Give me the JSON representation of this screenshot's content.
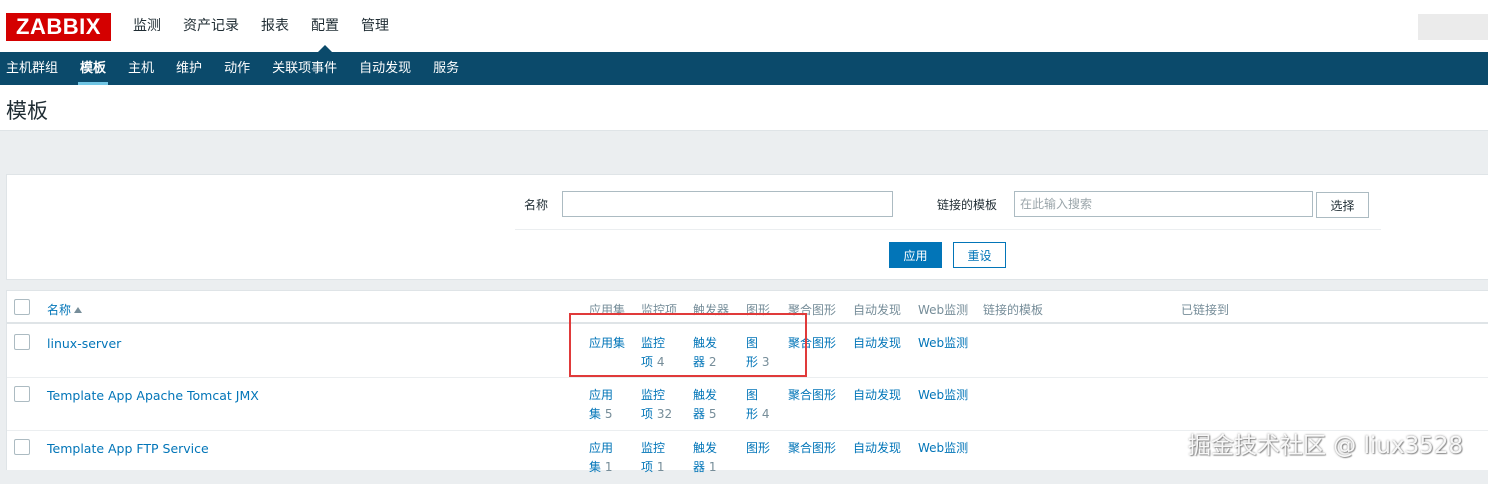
{
  "logo": "ZABBIX",
  "top_menu": [
    {
      "label": "监测",
      "active": false
    },
    {
      "label": "资产记录",
      "active": false
    },
    {
      "label": "报表",
      "active": false
    },
    {
      "label": "配置",
      "active": true
    },
    {
      "label": "管理",
      "active": false
    }
  ],
  "sub_menu": [
    {
      "label": "主机群组",
      "active": false
    },
    {
      "label": "模板",
      "active": true
    },
    {
      "label": "主机",
      "active": false
    },
    {
      "label": "维护",
      "active": false
    },
    {
      "label": "动作",
      "active": false
    },
    {
      "label": "关联项事件",
      "active": false
    },
    {
      "label": "自动发现",
      "active": false
    },
    {
      "label": "服务",
      "active": false
    }
  ],
  "page_title": "模板",
  "filter": {
    "name_label": "名称",
    "name_value": "",
    "linked_label": "链接的模板",
    "linked_placeholder": "在此输入搜索",
    "select_button": "选择",
    "apply_button": "应用",
    "reset_button": "重设"
  },
  "table": {
    "headers": {
      "name": "名称",
      "applications": "应用集",
      "items": "监控项",
      "triggers": "触发器",
      "graphs": "图形",
      "screens": "聚合图形",
      "discovery": "自动发现",
      "web": "Web监测",
      "linked_templates": "链接的模板",
      "linked_to": "已链接到"
    },
    "rows": [
      {
        "name": "linux-server",
        "app_a": "应用集",
        "app_b": "",
        "app_count": "",
        "items_a": "监控",
        "items_b": "项",
        "items_count": "4",
        "trig_a": "触发",
        "trig_b": "器",
        "trig_count": "2",
        "graph_a": "图",
        "graph_b": "形",
        "graph_count": "3",
        "screens": "聚合图形",
        "discovery": "自动发现",
        "web": "Web监测"
      },
      {
        "name": "Template App Apache Tomcat JMX",
        "app_a": "应用",
        "app_b": "集",
        "app_count": "5",
        "items_a": "监控",
        "items_b": "项",
        "items_count": "32",
        "trig_a": "触发",
        "trig_b": "器",
        "trig_count": "5",
        "graph_a": "图",
        "graph_b": "形",
        "graph_count": "4",
        "screens": "聚合图形",
        "discovery": "自动发现",
        "web": "Web监测"
      },
      {
        "name": "Template App FTP Service",
        "app_a": "应用",
        "app_b": "集",
        "app_count": "1",
        "items_a": "监控",
        "items_b": "项",
        "items_count": "1",
        "trig_a": "触发",
        "trig_b": "器",
        "trig_count": "1",
        "graph_a": "图形",
        "graph_b": "",
        "graph_count": "",
        "screens": "聚合图形",
        "discovery": "自动发现",
        "web": "Web监测"
      }
    ]
  },
  "watermark": "掘金技术社区 @ liux3528",
  "colors": {
    "brand_red": "#d40000",
    "nav_blue": "#0b4a6b",
    "link_blue": "#0275b8",
    "highlight_red": "#e03a3a"
  }
}
